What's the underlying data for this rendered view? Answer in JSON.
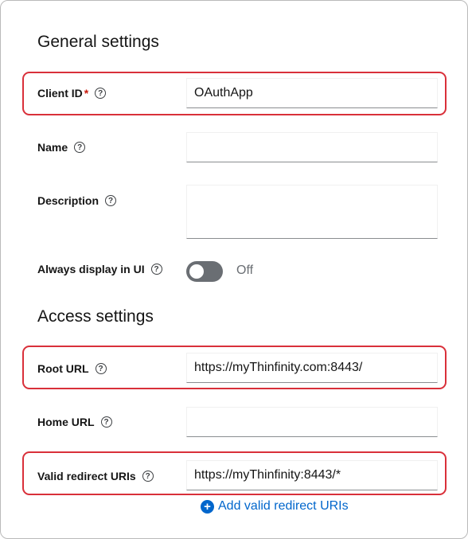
{
  "general": {
    "title": "General settings",
    "client_id": {
      "label": "Client ID",
      "required_marker": "*",
      "value": "OAuthApp"
    },
    "name": {
      "label": "Name",
      "value": ""
    },
    "description": {
      "label": "Description",
      "value": ""
    },
    "always_display": {
      "label": "Always display in UI",
      "state_text": "Off"
    }
  },
  "access": {
    "title": "Access settings",
    "root_url": {
      "label": "Root URL",
      "value": "https://myThinfinity.com:8443/"
    },
    "home_url": {
      "label": "Home URL",
      "value": ""
    },
    "valid_redirect": {
      "label": "Valid redirect URIs",
      "value": "https://myThinfinity:8443/*"
    },
    "add_redirect_label": "Add valid redirect URIs"
  },
  "help_glyph": "?",
  "add_glyph": "+",
  "colors": {
    "highlight": "#d9303a",
    "link": "#0066cc",
    "toggle_off": "#6a6e73"
  }
}
